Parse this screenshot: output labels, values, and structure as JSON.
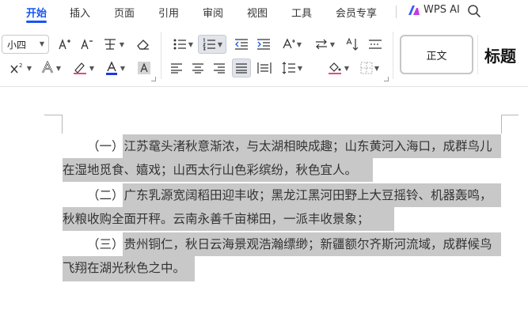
{
  "menubar": {
    "items": [
      {
        "label": "开始",
        "active": true
      },
      {
        "label": "插入"
      },
      {
        "label": "页面"
      },
      {
        "label": "引用"
      },
      {
        "label": "审阅"
      },
      {
        "label": "视图"
      },
      {
        "label": "工具"
      },
      {
        "label": "会员专享"
      }
    ],
    "wps_ai_label": "WPS AI",
    "accent_color": "#1656f5"
  },
  "toolbar": {
    "font_size": "小四",
    "styles": {
      "normal_label": "正文",
      "heading_label": "标题"
    }
  },
  "document": {
    "paragraphs": [
      {
        "lines": [
          "（一）江苏鼋头渚秋意渐浓，与太湖相映成趣；山东黄河入海口，成群鸟儿",
          "在湿地觅食、嬉戏；山西太行山色彩缤纷，秋色宜人。"
        ]
      },
      {
        "lines": [
          "（二）广东乳源宽阔稻田迎丰收；黑龙江黑河田野上大豆摇铃、机器轰鸣，",
          "秋粮收购全面开秤。云南永善千亩梯田，一派丰收景象；"
        ]
      },
      {
        "lines": [
          "（三）贵州铜仁，秋日云海景观浩瀚缥缈；新疆额尔齐斯河流域，成群候鸟",
          "飞翔在湖光秋色之中。"
        ]
      }
    ],
    "selection_color": "#c8c8c8"
  }
}
